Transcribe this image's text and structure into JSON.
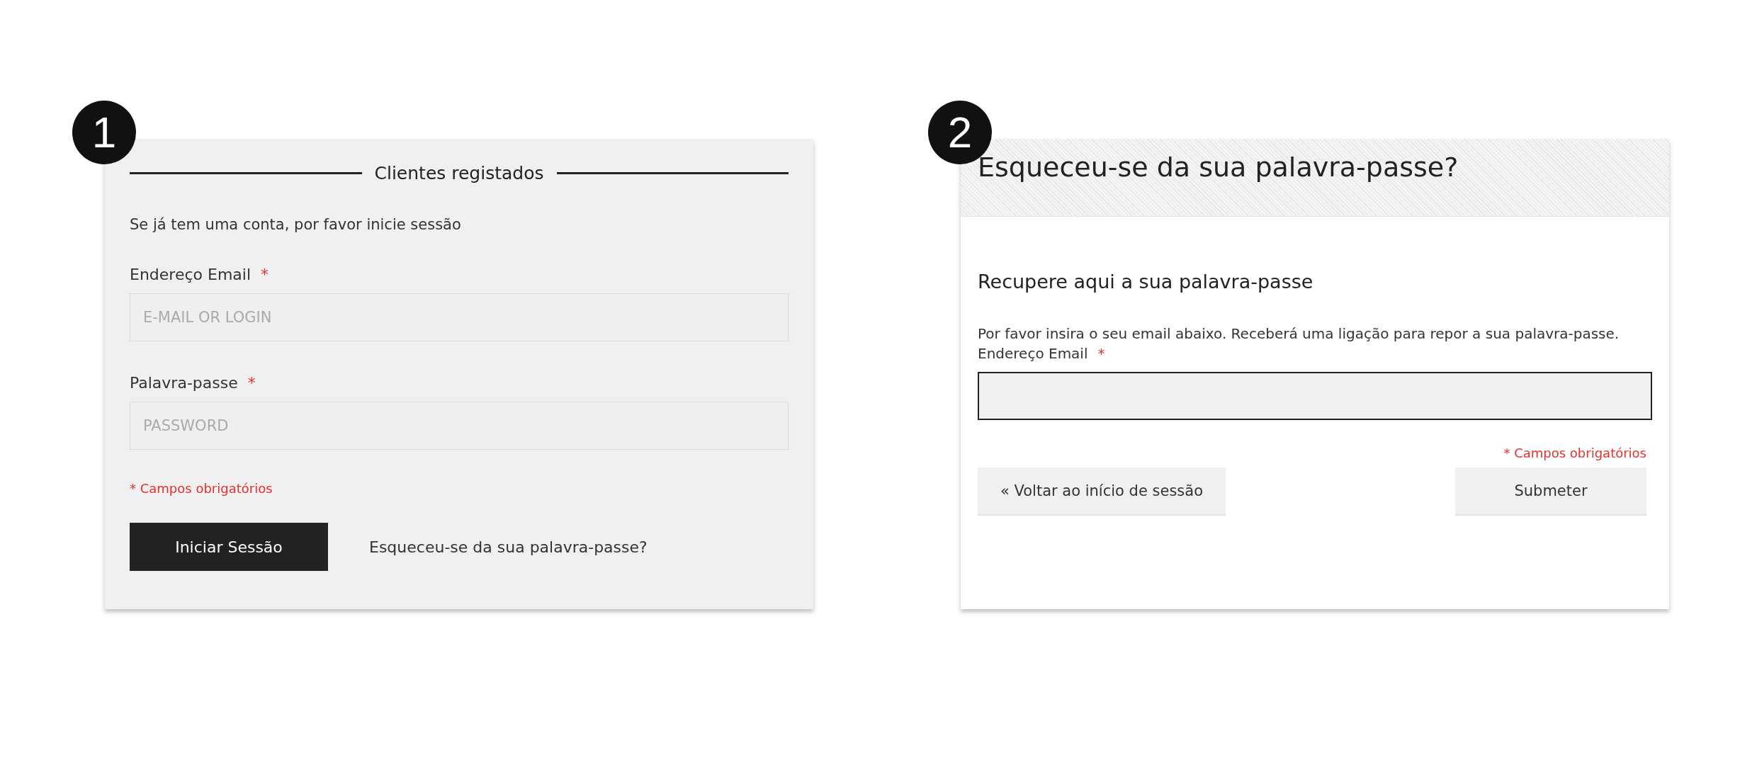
{
  "panels": [
    {
      "badge": "1",
      "kind": "login",
      "heading": "Clientes registados",
      "intro": "Se já tem uma conta, por favor inicie sessão",
      "fields": [
        {
          "label": "Endereço Email",
          "required_mark": "*",
          "placeholder": "E-MAIL OR LOGIN"
        },
        {
          "label": "Palavra-passe",
          "required_mark": "*",
          "placeholder": "PASSWORD"
        }
      ],
      "required_note": "* Campos obrigatórios",
      "submit_button": "Iniciar Sessão",
      "forgot_link": "Esqueceu-se da sua palavra-passe?"
    },
    {
      "badge": "2",
      "kind": "recover",
      "title": "Esqueceu-se da sua palavra-passe?",
      "subtitle": "Recupere aqui a sua palavra-passe",
      "intro": "Por favor insira o seu email abaixo. Receberá uma ligação para repor a sua palavra-passe.",
      "fields": [
        {
          "label": "Endereço Email",
          "required_mark": "*"
        }
      ],
      "required_note": "* Campos obrigatórios",
      "back_button": "« Voltar ao início de sessão",
      "submit_button": "Submeter"
    }
  ]
}
